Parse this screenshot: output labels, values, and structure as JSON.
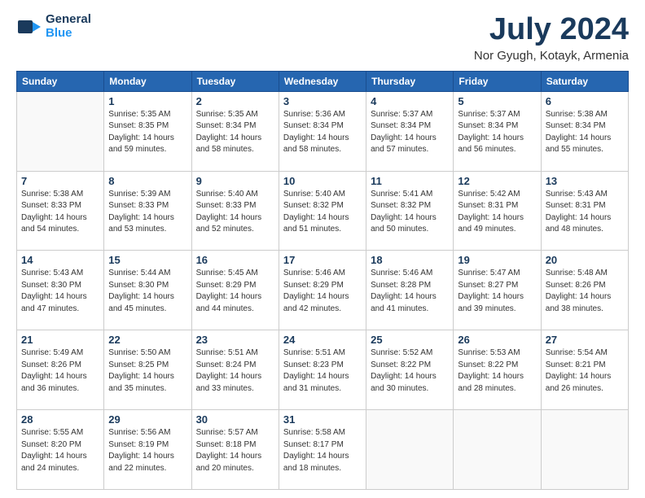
{
  "header": {
    "logo_line1": "General",
    "logo_line2": "Blue",
    "title": "July 2024",
    "subtitle": "Nor Gyugh, Kotayk, Armenia"
  },
  "calendar": {
    "headers": [
      "Sunday",
      "Monday",
      "Tuesday",
      "Wednesday",
      "Thursday",
      "Friday",
      "Saturday"
    ],
    "weeks": [
      [
        {
          "num": "",
          "info": ""
        },
        {
          "num": "1",
          "info": "Sunrise: 5:35 AM\nSunset: 8:35 PM\nDaylight: 14 hours\nand 59 minutes."
        },
        {
          "num": "2",
          "info": "Sunrise: 5:35 AM\nSunset: 8:34 PM\nDaylight: 14 hours\nand 58 minutes."
        },
        {
          "num": "3",
          "info": "Sunrise: 5:36 AM\nSunset: 8:34 PM\nDaylight: 14 hours\nand 58 minutes."
        },
        {
          "num": "4",
          "info": "Sunrise: 5:37 AM\nSunset: 8:34 PM\nDaylight: 14 hours\nand 57 minutes."
        },
        {
          "num": "5",
          "info": "Sunrise: 5:37 AM\nSunset: 8:34 PM\nDaylight: 14 hours\nand 56 minutes."
        },
        {
          "num": "6",
          "info": "Sunrise: 5:38 AM\nSunset: 8:34 PM\nDaylight: 14 hours\nand 55 minutes."
        }
      ],
      [
        {
          "num": "7",
          "info": "Sunrise: 5:38 AM\nSunset: 8:33 PM\nDaylight: 14 hours\nand 54 minutes."
        },
        {
          "num": "8",
          "info": "Sunrise: 5:39 AM\nSunset: 8:33 PM\nDaylight: 14 hours\nand 53 minutes."
        },
        {
          "num": "9",
          "info": "Sunrise: 5:40 AM\nSunset: 8:33 PM\nDaylight: 14 hours\nand 52 minutes."
        },
        {
          "num": "10",
          "info": "Sunrise: 5:40 AM\nSunset: 8:32 PM\nDaylight: 14 hours\nand 51 minutes."
        },
        {
          "num": "11",
          "info": "Sunrise: 5:41 AM\nSunset: 8:32 PM\nDaylight: 14 hours\nand 50 minutes."
        },
        {
          "num": "12",
          "info": "Sunrise: 5:42 AM\nSunset: 8:31 PM\nDaylight: 14 hours\nand 49 minutes."
        },
        {
          "num": "13",
          "info": "Sunrise: 5:43 AM\nSunset: 8:31 PM\nDaylight: 14 hours\nand 48 minutes."
        }
      ],
      [
        {
          "num": "14",
          "info": "Sunrise: 5:43 AM\nSunset: 8:30 PM\nDaylight: 14 hours\nand 47 minutes."
        },
        {
          "num": "15",
          "info": "Sunrise: 5:44 AM\nSunset: 8:30 PM\nDaylight: 14 hours\nand 45 minutes."
        },
        {
          "num": "16",
          "info": "Sunrise: 5:45 AM\nSunset: 8:29 PM\nDaylight: 14 hours\nand 44 minutes."
        },
        {
          "num": "17",
          "info": "Sunrise: 5:46 AM\nSunset: 8:29 PM\nDaylight: 14 hours\nand 42 minutes."
        },
        {
          "num": "18",
          "info": "Sunrise: 5:46 AM\nSunset: 8:28 PM\nDaylight: 14 hours\nand 41 minutes."
        },
        {
          "num": "19",
          "info": "Sunrise: 5:47 AM\nSunset: 8:27 PM\nDaylight: 14 hours\nand 39 minutes."
        },
        {
          "num": "20",
          "info": "Sunrise: 5:48 AM\nSunset: 8:26 PM\nDaylight: 14 hours\nand 38 minutes."
        }
      ],
      [
        {
          "num": "21",
          "info": "Sunrise: 5:49 AM\nSunset: 8:26 PM\nDaylight: 14 hours\nand 36 minutes."
        },
        {
          "num": "22",
          "info": "Sunrise: 5:50 AM\nSunset: 8:25 PM\nDaylight: 14 hours\nand 35 minutes."
        },
        {
          "num": "23",
          "info": "Sunrise: 5:51 AM\nSunset: 8:24 PM\nDaylight: 14 hours\nand 33 minutes."
        },
        {
          "num": "24",
          "info": "Sunrise: 5:51 AM\nSunset: 8:23 PM\nDaylight: 14 hours\nand 31 minutes."
        },
        {
          "num": "25",
          "info": "Sunrise: 5:52 AM\nSunset: 8:22 PM\nDaylight: 14 hours\nand 30 minutes."
        },
        {
          "num": "26",
          "info": "Sunrise: 5:53 AM\nSunset: 8:22 PM\nDaylight: 14 hours\nand 28 minutes."
        },
        {
          "num": "27",
          "info": "Sunrise: 5:54 AM\nSunset: 8:21 PM\nDaylight: 14 hours\nand 26 minutes."
        }
      ],
      [
        {
          "num": "28",
          "info": "Sunrise: 5:55 AM\nSunset: 8:20 PM\nDaylight: 14 hours\nand 24 minutes."
        },
        {
          "num": "29",
          "info": "Sunrise: 5:56 AM\nSunset: 8:19 PM\nDaylight: 14 hours\nand 22 minutes."
        },
        {
          "num": "30",
          "info": "Sunrise: 5:57 AM\nSunset: 8:18 PM\nDaylight: 14 hours\nand 20 minutes."
        },
        {
          "num": "31",
          "info": "Sunrise: 5:58 AM\nSunset: 8:17 PM\nDaylight: 14 hours\nand 18 minutes."
        },
        {
          "num": "",
          "info": ""
        },
        {
          "num": "",
          "info": ""
        },
        {
          "num": "",
          "info": ""
        }
      ]
    ]
  }
}
